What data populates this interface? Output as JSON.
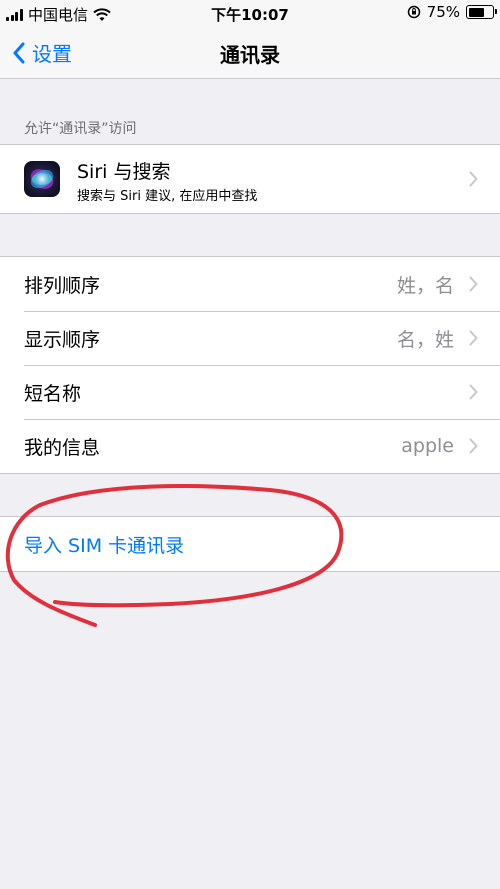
{
  "status_bar": {
    "carrier": "中国电信",
    "time": "下午10:07",
    "battery_percent_label": "75%",
    "battery_level": 0.75
  },
  "nav": {
    "back_label": "设置",
    "title": "通讯录"
  },
  "allow_access_header": "允许“通讯录”访问",
  "siri": {
    "title": "Siri 与搜索",
    "subtitle": "搜索与 Siri 建议, 在应用中查找"
  },
  "settings": [
    {
      "label": "排列顺序",
      "value": "姓，名"
    },
    {
      "label": "显示顺序",
      "value": "名，姓"
    },
    {
      "label": "短名称",
      "value": ""
    },
    {
      "label": "我的信息",
      "value": "apple"
    }
  ],
  "import_sim_label": "导入 SIM 卡通讯录",
  "colors": {
    "accent": "#007aff",
    "annotation": "#e0303c",
    "background": "#efeff4"
  }
}
